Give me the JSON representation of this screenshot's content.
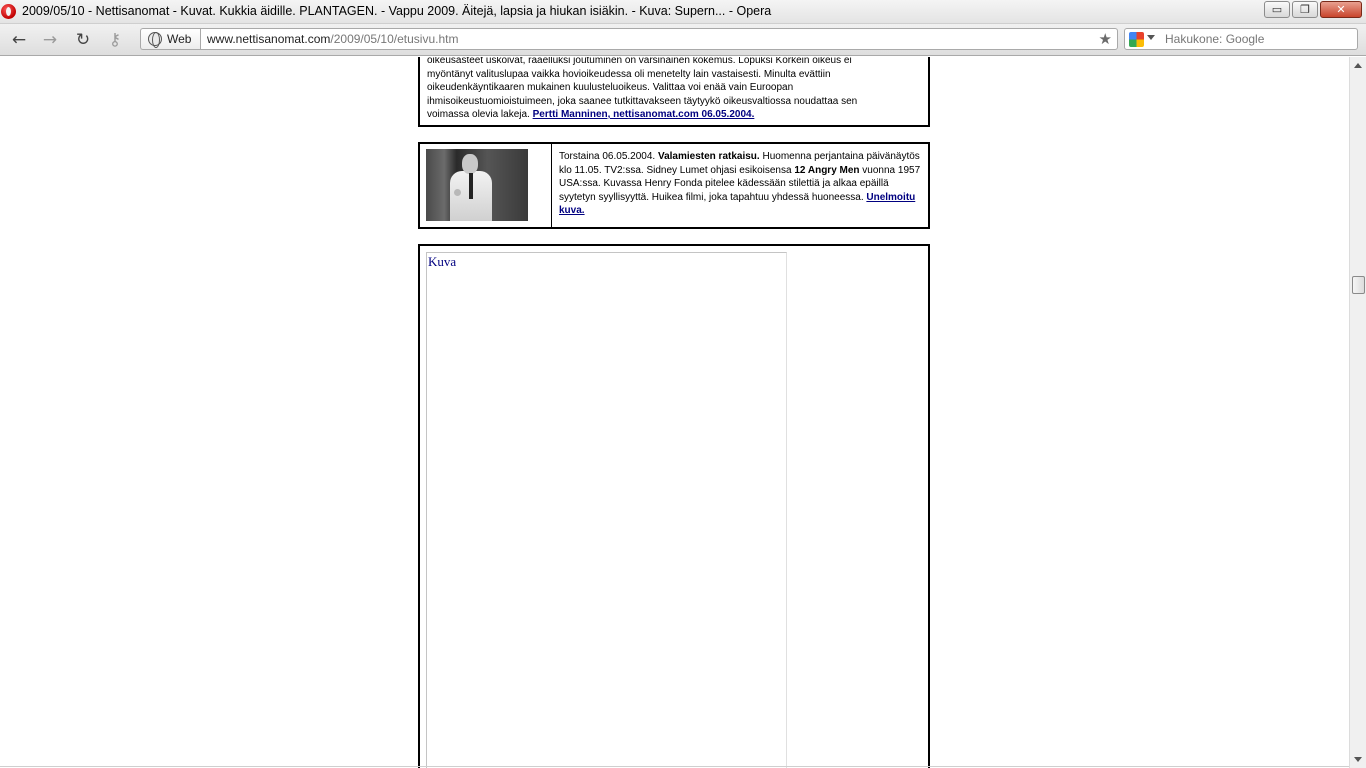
{
  "window": {
    "title": "2009/05/10 - Nettisanomat - Kuvat. Kukkia äidille. PLANTAGEN. - Vappu 2009. Äitejä, lapsia ja hiukan isiäkin. - Kuva: Supern... - Opera",
    "minimize_glyph": "▭",
    "maximize_glyph": "❐",
    "close_glyph": "✕"
  },
  "toolbar": {
    "back_icon": "←",
    "forward_icon": "→",
    "reload_icon": "↻",
    "key_icon": "⚷",
    "badge_label": "Web",
    "address_host": "www.nettisanomat.com",
    "address_path": "/2009/05/10/etusivu.htm",
    "star_icon": "★",
    "search_placeholder": "Hakukone: Google"
  },
  "article1": {
    "text": "oikeusasteet uskoivat, rääelluksi joutuminen on varsinainen kokemus. Lopuksi Korkein oikeus ei myöntänyt valituslupaa vaikka hovioikeudessa oli menetelty lain vastaisesti. Minulta evättiin oikeudenkäyntikaaren mukainen kuulusteluoikeus. Valittaa voi enää vain Euroopan ihmisoikeustuomioistuimeen, joka saanee tutkittavakseen täytyykö oikeusvaltiossa  noudattaa sen voimassa olevia lakeja. ",
    "link": "Pertti Manninen, nettisanomat.com 06.05.2004."
  },
  "article2": {
    "date": "Torstaina 06.05.2004. ",
    "heading": "Valamiesten ratkaisu.",
    "text_a": " Huomenna perjantaina päivänäytös klo 11.05. TV2:ssa. Sidney Lumet ohjasi esikoisensa ",
    "film": "12 Angry Men",
    "text_b": " vuonna 1957 USA:ssa. Kuvassa Henry Fonda pitelee kädessään stilettiä ja alkaa epäillä syytetyn syyllisyyttä. Huikea filmi, joka tapahtuu yhdessä huoneessa. ",
    "link": "Unelmoitu kuva."
  },
  "frame": {
    "label": "Kuva"
  }
}
